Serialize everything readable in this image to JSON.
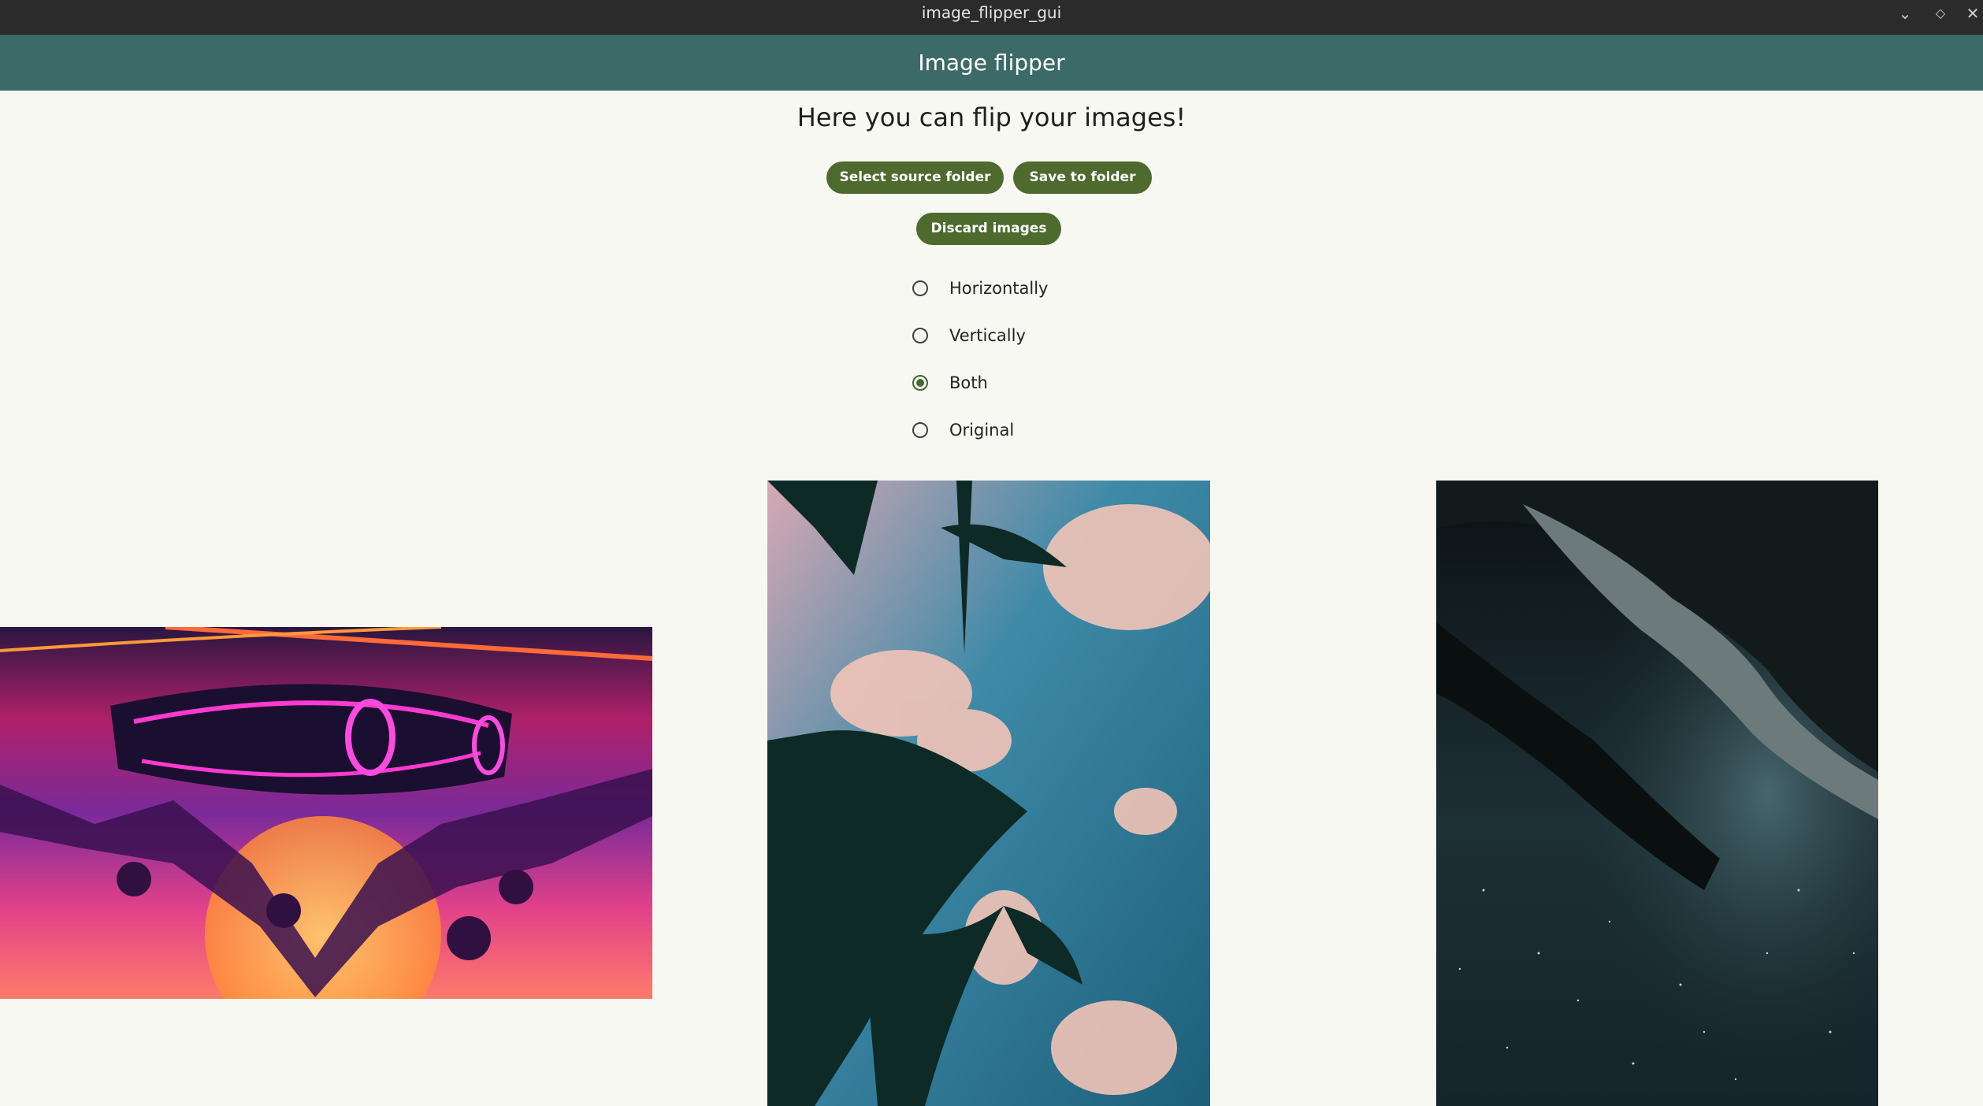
{
  "window": {
    "title": "image_flipper_gui",
    "controls": [
      "chevron-down-icon",
      "diamond-icon",
      "close-icon"
    ]
  },
  "appbar": {
    "title": "Image flipper"
  },
  "main": {
    "heading": "Here you can flip your images!",
    "buttons": {
      "select_source": "Select source folder",
      "save_to_folder": "Save to folder",
      "discard_images": "Discard images"
    },
    "flip_options": [
      {
        "label": "Horizontally",
        "checked": false
      },
      {
        "label": "Vertically",
        "checked": false
      },
      {
        "label": "Both",
        "checked": true
      },
      {
        "label": "Original",
        "checked": false
      }
    ],
    "selected_option": "Both"
  },
  "colors": {
    "appbar": "#3b6a68",
    "button": "#4e6a2e",
    "background": "#f7f8f1",
    "titlebar": "#2b2b2b"
  }
}
